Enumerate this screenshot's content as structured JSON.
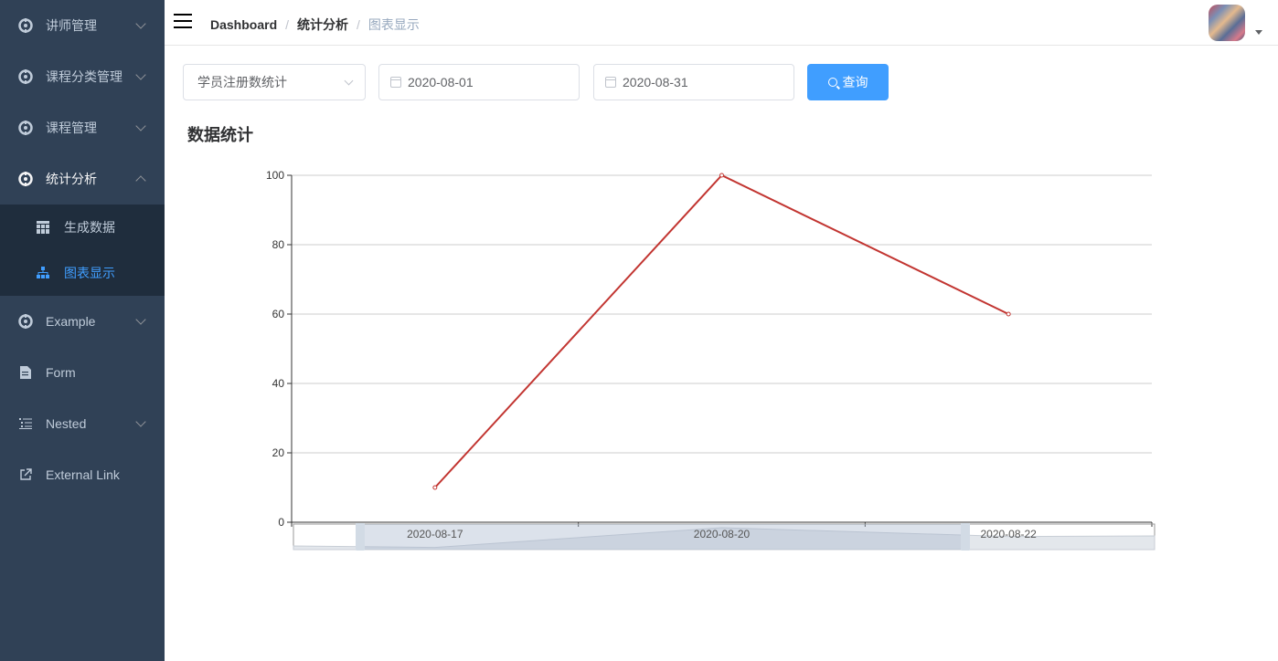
{
  "sidebar": {
    "items": [
      {
        "label": "讲师管理",
        "icon": "gear-icon",
        "has_children": true
      },
      {
        "label": "课程分类管理",
        "icon": "gear-icon",
        "has_children": true
      },
      {
        "label": "课程管理",
        "icon": "gear-icon",
        "has_children": true
      },
      {
        "label": "统计分析",
        "icon": "gear-icon",
        "has_children": true,
        "expanded": true,
        "children": [
          {
            "label": "生成数据",
            "icon": "table-icon"
          },
          {
            "label": "图表显示",
            "icon": "tree-icon",
            "active": true
          }
        ]
      },
      {
        "label": "Example",
        "icon": "gear-icon",
        "has_children": true
      },
      {
        "label": "Form",
        "icon": "form-icon"
      },
      {
        "label": "Nested",
        "icon": "nested-icon",
        "has_children": true
      },
      {
        "label": "External Link",
        "icon": "link-icon"
      }
    ]
  },
  "navbar": {
    "breadcrumb": [
      "Dashboard",
      "统计分析",
      "图表显示"
    ],
    "separator": "/"
  },
  "filters": {
    "type_select": "学员注册数统计",
    "begin_date": "2020-08-01",
    "end_date": "2020-08-31",
    "search_label": "查询"
  },
  "page_title": "数据统计",
  "colors": {
    "sidebar_bg": "#304156",
    "submenu_bg": "#1f2d3d",
    "accent": "#409eff",
    "series": "#c23531"
  },
  "chart_data": {
    "type": "line",
    "categories": [
      "2020-08-17",
      "2020-08-20",
      "2020-08-22"
    ],
    "series": [
      {
        "values": [
          10,
          100,
          60
        ]
      }
    ],
    "yticks": [
      0,
      20,
      40,
      60,
      80,
      100
    ],
    "ylim": [
      0,
      100
    ],
    "grid": true,
    "data_zoom": true
  }
}
